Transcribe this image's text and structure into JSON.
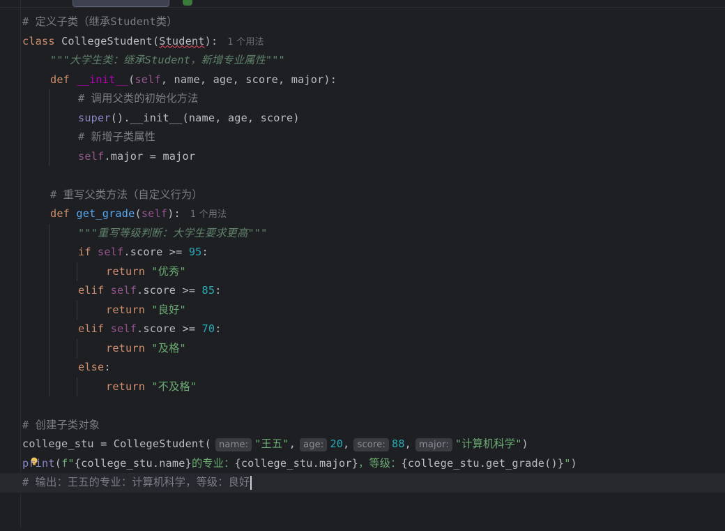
{
  "lines": {
    "l1": {
      "comment": "# 定义子类（继承Student类）"
    },
    "l2": {
      "kw": "class",
      "name": "CollegeStudent",
      "base": "Student",
      "tail": "):",
      "hint": "1 个用法"
    },
    "l3": {
      "doc": "\"\"\"大学生类：继承Student，新增专业属性\"\"\""
    },
    "l4": {
      "kw": "def",
      "name": "__init__",
      "open": "(",
      "self": "self",
      "params": ", name, age, score, major):"
    },
    "l5": {
      "comment": "# 调用父类的初始化方法"
    },
    "l6": {
      "super": "super",
      "mid": "().",
      "init": "__init__",
      "args": "(name, age, score)"
    },
    "l7": {
      "comment": "# 新增子类属性"
    },
    "l8": {
      "self": "self",
      "rest": ".major = major"
    },
    "l10": {
      "comment": "# 重写父类方法（自定义行为）"
    },
    "l11": {
      "kw": "def",
      "name": "get_grade",
      "open": "(",
      "self": "self",
      "close": "):",
      "hint": "1 个用法"
    },
    "l12": {
      "doc": "\"\"\"重写等级判断：大学生要求更高\"\"\""
    },
    "l13": {
      "kw": "if",
      "self": "self",
      "cmp": ".score >= ",
      "num": "95",
      "colon": ":"
    },
    "l14": {
      "kw": "return",
      "str": "\"优秀\""
    },
    "l15": {
      "kw": "elif",
      "self": "self",
      "cmp": ".score >= ",
      "num": "85",
      "colon": ":"
    },
    "l16": {
      "kw": "return",
      "str": "\"良好\""
    },
    "l17": {
      "kw": "elif",
      "self": "self",
      "cmp": ".score >= ",
      "num": "70",
      "colon": ":"
    },
    "l18": {
      "kw": "return",
      "str": "\"及格\""
    },
    "l19": {
      "kw": "else",
      "colon": ":"
    },
    "l20": {
      "kw": "return",
      "str": "\"不及格\""
    },
    "l22": {
      "comment": "# 创建子类对象"
    },
    "l23": {
      "var": "college_stu = CollegeStudent(",
      "hint_name": "name:",
      "val_name": "\"王五\"",
      "sep1": ",",
      "hint_age": "age:",
      "val_age": "20",
      "sep2": ",",
      "hint_score": "score:",
      "val_score": "88",
      "sep3": ",",
      "hint_major": "major:",
      "val_major": "\"计算机科学\"",
      "close": ")"
    },
    "l24": {
      "print": "print",
      "open": "(",
      "fpre": "f\"",
      "e1": "{college_stu.name}",
      "s1": "的专业：",
      "e2": "{college_stu.major}",
      "s2": "，等级：",
      "e3": "{college_stu.get_grade()}",
      "fend": "\"",
      "close": ")"
    },
    "l25": {
      "comment": "# 输出：王五的专业：计算机科学，等级：良好"
    }
  },
  "colors": {
    "background": "#1e1f22",
    "keyword": "#cf8e6d",
    "function": "#56a8f5",
    "string": "#6aab73",
    "number": "#2aacb8",
    "comment": "#7a7e85",
    "self": "#94558d"
  },
  "icons": {
    "intention": "lightbulb-icon"
  }
}
